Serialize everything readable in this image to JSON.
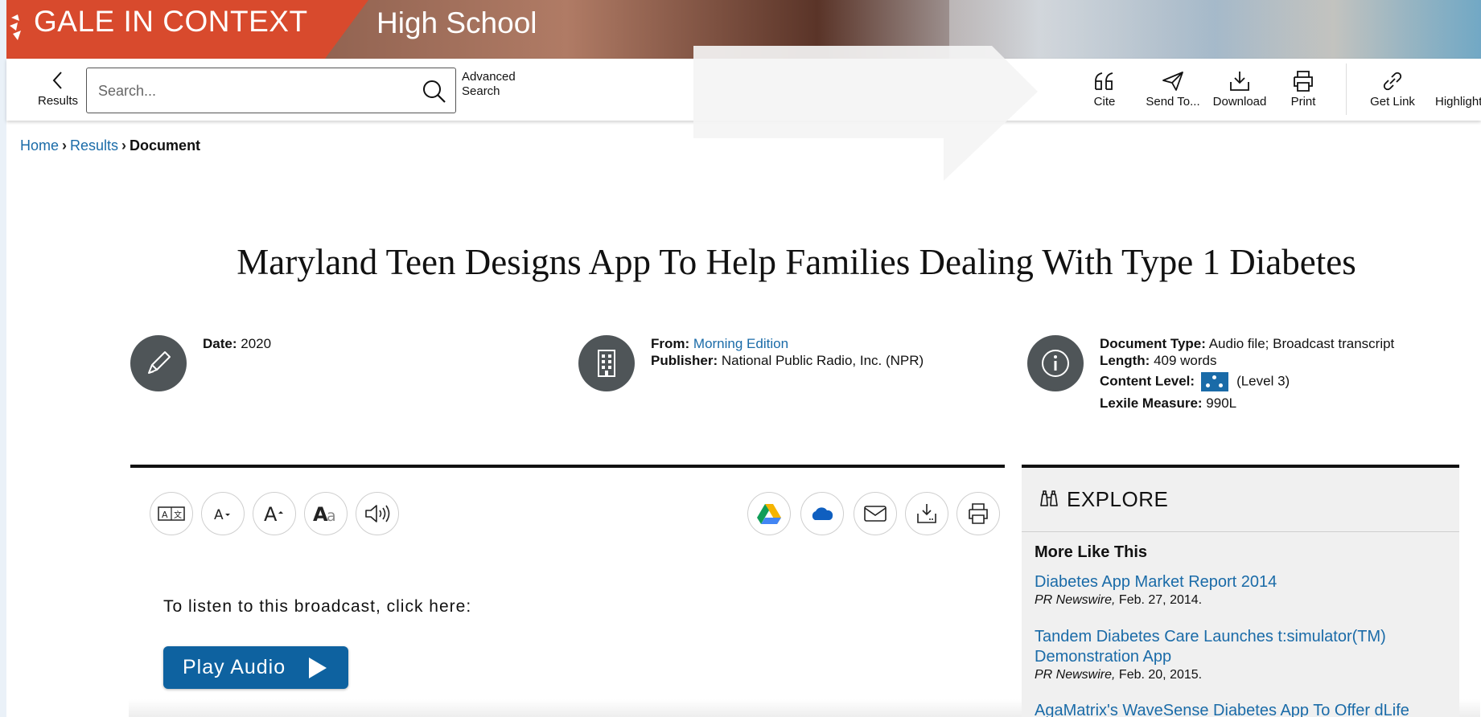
{
  "header": {
    "brand": "GALE IN CONTEXT",
    "edition": "High School"
  },
  "toolbar": {
    "back_label": "Results",
    "search_placeholder": "Search...",
    "advanced_line1": "Advanced",
    "advanced_line2": "Search",
    "actions": {
      "cite": "Cite",
      "send_to": "Send To...",
      "download": "Download",
      "print": "Print",
      "get_link": "Get Link",
      "highlight": "Highlight"
    }
  },
  "breadcrumb": {
    "home": "Home",
    "results": "Results",
    "current": "Document"
  },
  "document": {
    "title": "Maryland Teen Designs App To Help Families Dealing With Type 1 Diabetes",
    "date_label": "Date:",
    "date": "2020",
    "from_label": "From:",
    "from": "Morning Edition",
    "publisher_label": "Publisher:",
    "publisher": "National Public Radio, Inc. (NPR)",
    "doctype_label": "Document Type:",
    "doctype": "Audio file; Broadcast transcript",
    "length_label": "Length:",
    "length": "409 words",
    "content_level_label": "Content Level:",
    "content_level": "(Level 3)",
    "lexile_label": "Lexile Measure:",
    "lexile": "990L"
  },
  "article": {
    "listen_text": "To listen to this broadcast, click here:",
    "play_label": "Play Audio"
  },
  "explore": {
    "heading": "EXPLORE",
    "section": "More Like This",
    "items": [
      {
        "title": "Diabetes App Market Report 2014",
        "source": "PR Newswire,",
        "date": "Feb. 27, 2014."
      },
      {
        "title": "Tandem Diabetes Care Launches t:simulator(TM) Demonstration App",
        "source": "PR Newswire,",
        "date": "Feb. 20, 2015."
      },
      {
        "title": "AgaMatrix's WaveSense Diabetes App To Offer dLife"
      }
    ]
  },
  "colors": {
    "brand_red": "#d84a2d",
    "link_blue": "#1a6ba8",
    "button_blue": "#0e62a0",
    "icon_gray": "#4f5558"
  }
}
